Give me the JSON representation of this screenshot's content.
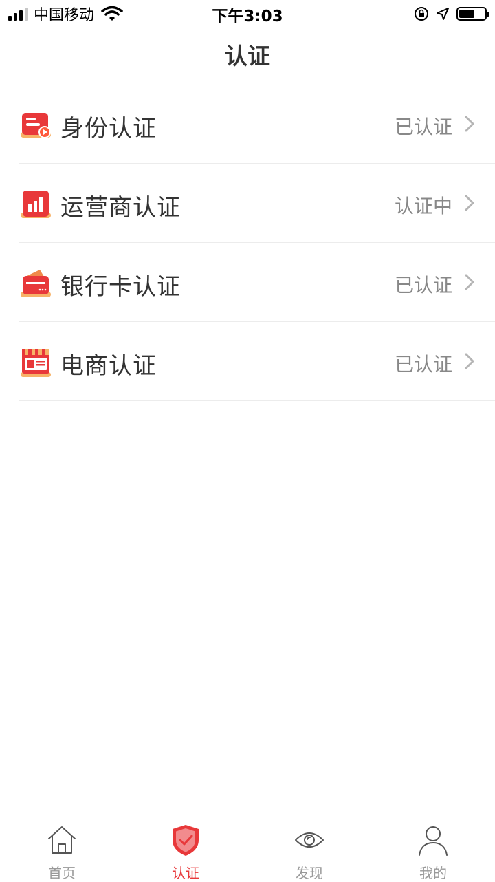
{
  "status_bar": {
    "carrier": "中国移动",
    "time": "下午3:03",
    "battery_level": 0.6
  },
  "header": {
    "title": "认证"
  },
  "colors": {
    "accent": "#e8383a",
    "status_text": "#888888",
    "divider": "#ececec"
  },
  "items": [
    {
      "label": "身份认证",
      "status": "已认证",
      "icon": "id-card-icon"
    },
    {
      "label": "运营商认证",
      "status": "认证中",
      "icon": "carrier-chart-icon"
    },
    {
      "label": "银行卡认证",
      "status": "已认证",
      "icon": "bank-card-wallet-icon"
    },
    {
      "label": "电商认证",
      "status": "已认证",
      "icon": "shop-storefront-icon"
    }
  ],
  "tabbar": {
    "tabs": [
      {
        "label": "首页",
        "icon": "home-icon",
        "active": false
      },
      {
        "label": "认证",
        "icon": "shield-check-icon",
        "active": true
      },
      {
        "label": "发现",
        "icon": "eye-icon",
        "active": false
      },
      {
        "label": "我的",
        "icon": "user-icon",
        "active": false
      }
    ]
  }
}
